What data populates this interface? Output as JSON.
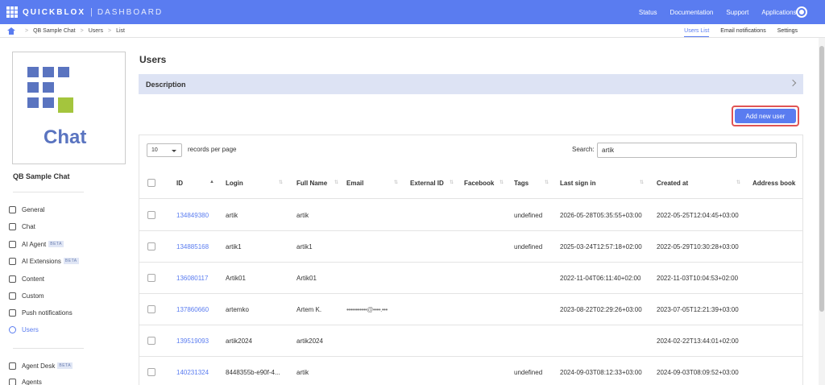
{
  "header": {
    "brand": "QUICKBLOX",
    "product": "DASHBOARD",
    "nav": [
      "Status",
      "Documentation",
      "Support",
      "Applications"
    ]
  },
  "breadcrumb": [
    "QB Sample Chat",
    "Users",
    "List"
  ],
  "subtabs": [
    "Users List",
    "Email notifications",
    "Settings"
  ],
  "app": {
    "logo_word": "Chat",
    "name": "QB Sample Chat"
  },
  "sidebar": {
    "items": [
      {
        "label": "General",
        "beta": ""
      },
      {
        "label": "Chat",
        "beta": ""
      },
      {
        "label": "AI Agent",
        "beta": "BETA"
      },
      {
        "label": "AI Extensions",
        "beta": "BETA"
      },
      {
        "label": "Content",
        "beta": ""
      },
      {
        "label": "Custom",
        "beta": ""
      },
      {
        "label": "Push notifications",
        "beta": ""
      },
      {
        "label": "Users",
        "beta": ""
      }
    ],
    "items2": [
      {
        "label": "Agent Desk",
        "beta": "BETA"
      },
      {
        "label": "Agents",
        "beta": ""
      }
    ]
  },
  "main": {
    "title": "Users",
    "description_label": "Description",
    "add_button": "Add new user",
    "length_value": "10",
    "length_label": "records per page",
    "search_label": "Search:",
    "search_value": "artik"
  },
  "table": {
    "columns": [
      "ID",
      "Login",
      "Full Name",
      "Email",
      "External ID",
      "Facebook",
      "Tags",
      "Last sign in",
      "Created at",
      "Address book"
    ],
    "rows": [
      {
        "id": "134849380",
        "login": "artik",
        "name": "artik",
        "email": "",
        "tags": "undefined",
        "last_sign_in": "2026-05-28T05:35:55+03:00",
        "created": "2022-05-25T12:04:45+03:00"
      },
      {
        "id": "134885168",
        "login": "artik1",
        "name": "artik1",
        "email": "",
        "tags": "undefined",
        "last_sign_in": "2025-03-24T12:57:18+02:00",
        "created": "2022-05-29T10:30:28+03:00"
      },
      {
        "id": "136080117",
        "login": "Artik01",
        "name": "Artik01",
        "email": "",
        "tags": "",
        "last_sign_in": "2022-11-04T06:11:40+02:00",
        "created": "2022-11-03T10:04:53+02:00"
      },
      {
        "id": "137860660",
        "login": "artemko",
        "name": "Artem K.",
        "email": "•••••••••••@••••.•••",
        "tags": "",
        "last_sign_in": "2023-08-22T02:29:26+03:00",
        "created": "2023-07-05T12:21:39+03:00"
      },
      {
        "id": "139519093",
        "login": "artik2024",
        "name": "artik2024",
        "email": "",
        "tags": "",
        "last_sign_in": "",
        "created": "2024-02-22T13:44:01+02:00"
      },
      {
        "id": "140231324",
        "login": "8448355b-e90f-4...",
        "name": "artik",
        "email": "",
        "tags": "undefined",
        "last_sign_in": "2024-09-03T08:12:33+03:00",
        "created": "2024-09-03T08:09:52+03:00"
      }
    ]
  }
}
